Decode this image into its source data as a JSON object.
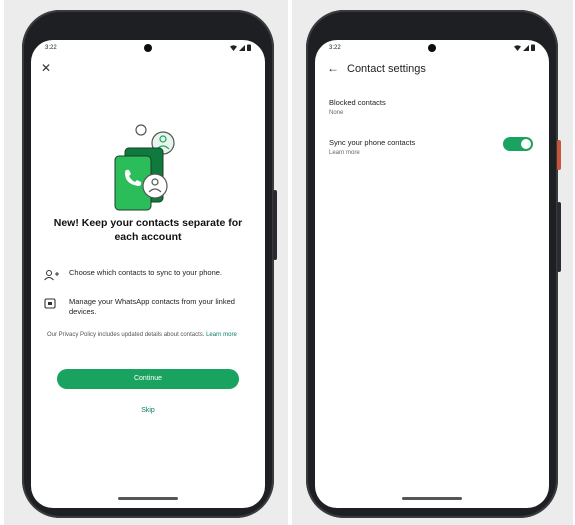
{
  "status_bar": {
    "time": "3:22"
  },
  "onboarding": {
    "title": "New! Keep your contacts separate for each account",
    "features": [
      {
        "icon": "contact-sync-icon",
        "text": "Choose which contacts to sync to your phone."
      },
      {
        "icon": "linked-devices-icon",
        "text": "Manage your WhatsApp contacts from your linked devices."
      }
    ],
    "policy_text": "Our Privacy Policy includes updated details about contacts.",
    "policy_link": "Learn more",
    "continue_label": "Continue",
    "skip_label": "Skip"
  },
  "contact_settings": {
    "title": "Contact settings",
    "blocked_label": "Blocked contacts",
    "blocked_value": "None",
    "sync_label": "Sync your phone contacts",
    "sync_link": "Learn more",
    "sync_enabled": true
  },
  "colors": {
    "accent": "#1aa260",
    "link": "#0a7c66",
    "phone_frame": "#1e1f22"
  }
}
